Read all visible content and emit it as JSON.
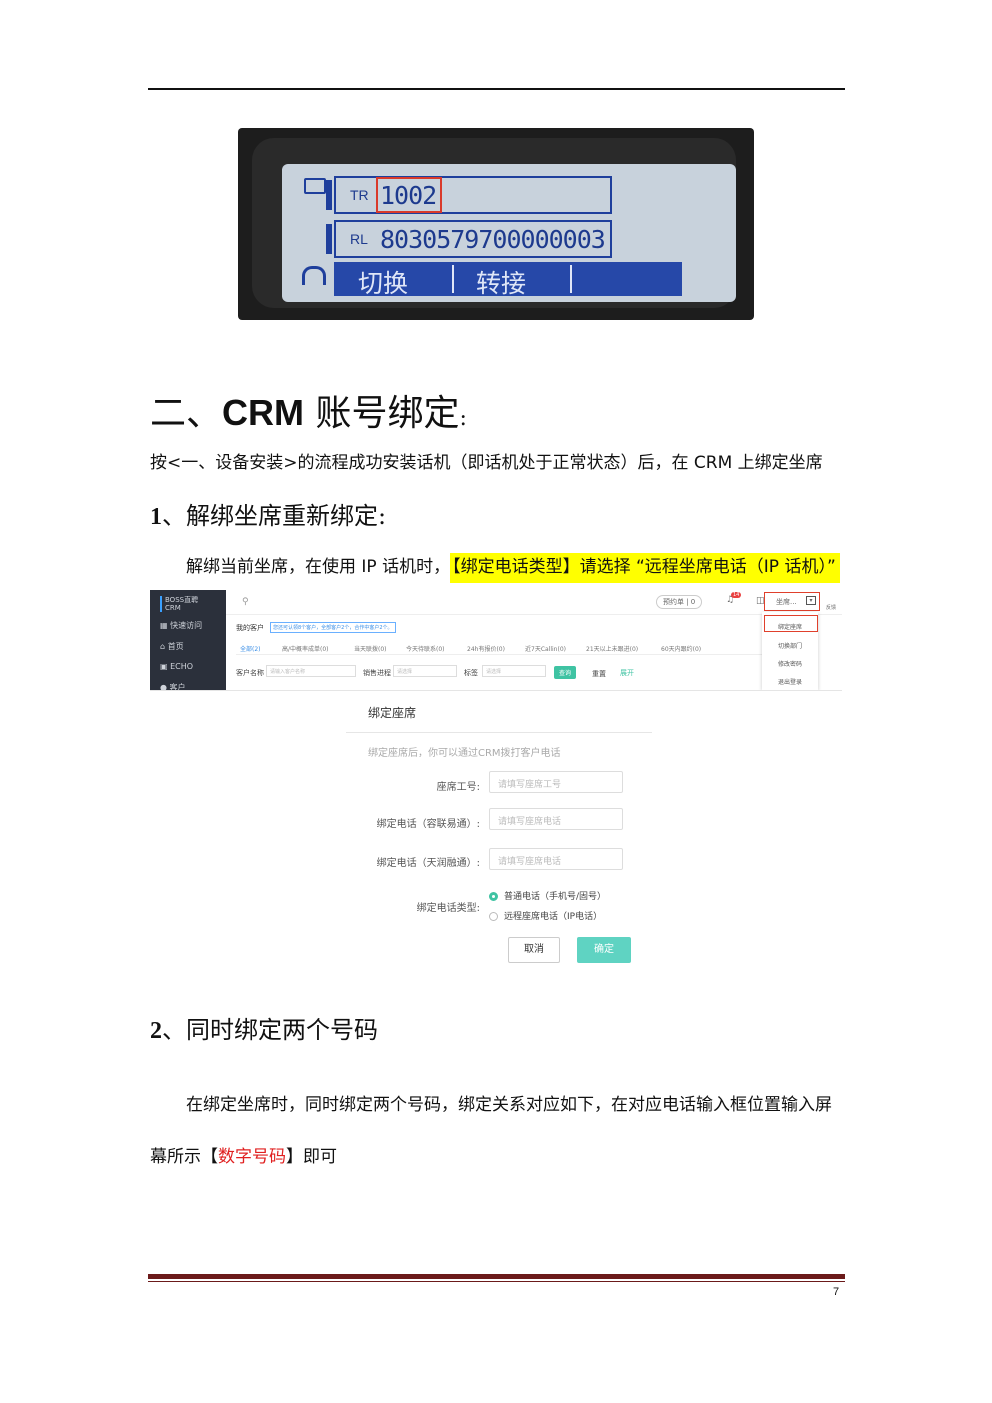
{
  "lcd": {
    "row1_tag": "TR",
    "row1_value": "1002",
    "row2_tag": "RL",
    "row2_value": "8030579700000003",
    "softkey1": "切换",
    "softkey2": "转接"
  },
  "section": {
    "heading_prefix": "二、",
    "heading_bold": "CRM",
    "heading_suffix": " 账号绑定",
    "heading_colon": ":",
    "intro": "按<一、设备安装>的流程成功安装话机（即话机处于正常状态）后，在 CRM 上绑定坐席"
  },
  "sub1": {
    "num": "1",
    "title": "、解绑坐席重新绑定:",
    "text_plain": "解绑当前坐席，在使用 IP 话机时，",
    "text_highlight": "【绑定电话类型】请选择 “远程坐席电话（IP 话机）”"
  },
  "crm": {
    "logo_line1": "BOSS直聘",
    "logo_line2": "CRM",
    "nav": [
      "快速访问",
      "首页",
      "ECHO",
      "客户"
    ],
    "breadcrumb": "我的客户",
    "tip": "您还可认领8个客户，全部客户2个，合作中客户2个。",
    "tabs": [
      "全部(2)",
      "高/中概率成单(0)",
      "当天联拨(0)",
      "今天待联系(0)",
      "24h有报价(0)",
      "近7天Callin(0)",
      "21天以上未跟进(0)",
      "60天内跟约(0)"
    ],
    "filter_name_label": "客户名称",
    "filter_name_ph": "请输入客户名称",
    "filter_stage_label": "销售进程",
    "filter_stage_ph": "请选择",
    "filter_tag_label": "标签",
    "filter_tag_ph": "请选择",
    "btn_search": "查询",
    "btn_reset": "重置",
    "btn_expand": "展开",
    "order_label": "预约单 | 0",
    "badge": "14",
    "user_label": "坐席...",
    "feedback": "反馈",
    "menu": [
      "绑定座席",
      "切换部门",
      "修改密码",
      "退出登录"
    ]
  },
  "dialog": {
    "title": "绑定座席",
    "hint": "绑定座席后，你可以通过CRM拨打客户电话",
    "fields": [
      {
        "label": "座席工号:",
        "placeholder": "请填写座席工号"
      },
      {
        "label": "绑定电话（容联易通）:",
        "placeholder": "请填写座席电话"
      },
      {
        "label": "绑定电话（天润融通）:",
        "placeholder": "请填写座席电话"
      }
    ],
    "type_label": "绑定电话类型:",
    "radio1": "普通电话（手机号/固号）",
    "radio2": "远程座席电话（IP电话）",
    "cancel": "取消",
    "confirm": "确定"
  },
  "sub2": {
    "num": "2",
    "title": "、同时绑定两个号码",
    "para_line1": "在绑定坐席时，同时绑定两个号码，绑定关系对应如下，在对应电话输入框位置输入屏",
    "para_line2_a": "幕所示【",
    "para_line2_red": "数字号码",
    "para_line2_b": "】即可"
  },
  "page_number": "7"
}
